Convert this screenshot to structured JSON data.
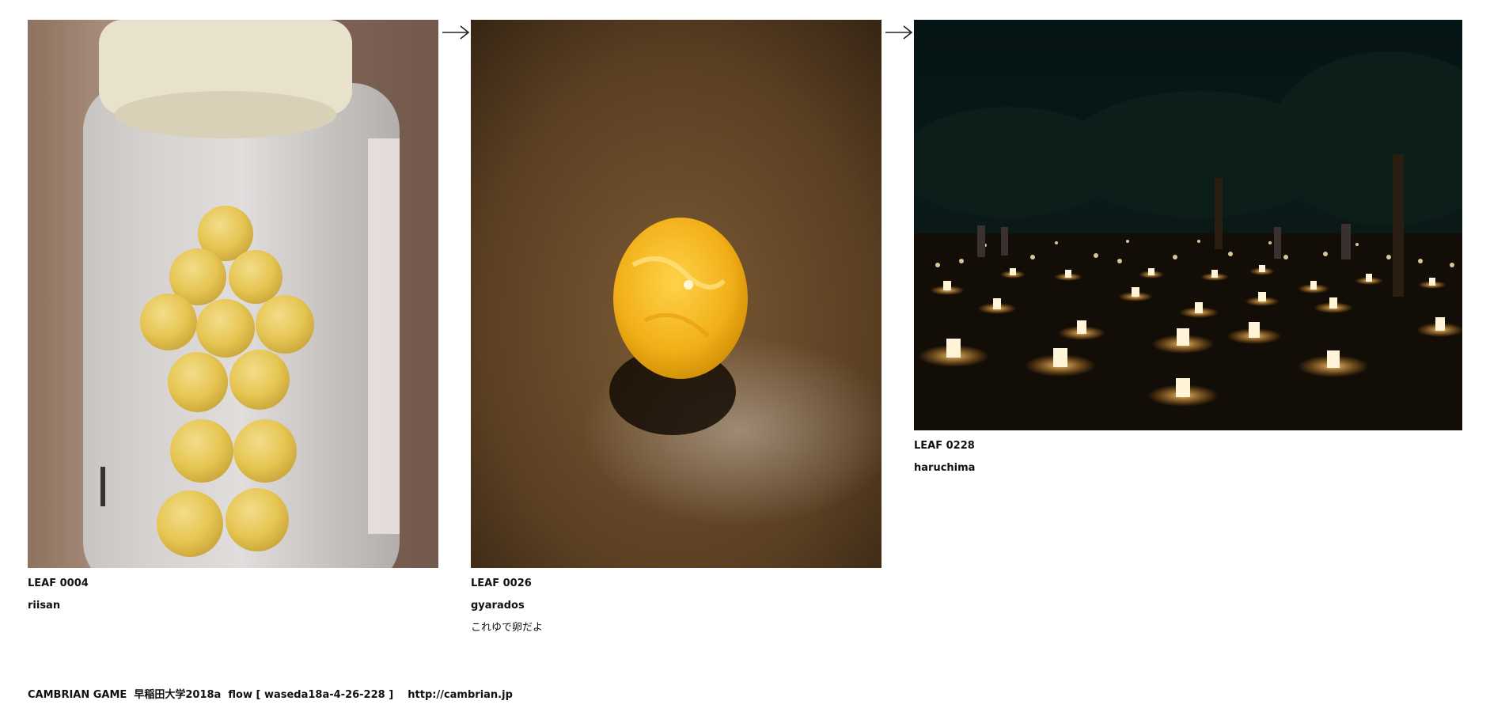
{
  "leaves": [
    {
      "leaf": "LEAF 0004",
      "user": "riisan",
      "comment": "",
      "image": "jar-of-yellow-balls"
    },
    {
      "leaf": "LEAF 0026",
      "user": "gyarados",
      "comment": "これゆで卵だよ",
      "image": "yellow-dyed-egg"
    },
    {
      "leaf": "LEAF 0228",
      "user": "haruchima",
      "comment": "",
      "image": "night-lanterns-park"
    }
  ],
  "footer": {
    "brand": "CAMBRIAN GAME",
    "flow": "早稲田大学2018a  flow [ waseda18a-4-26-228 ]",
    "url": "http://cambrian.jp"
  }
}
